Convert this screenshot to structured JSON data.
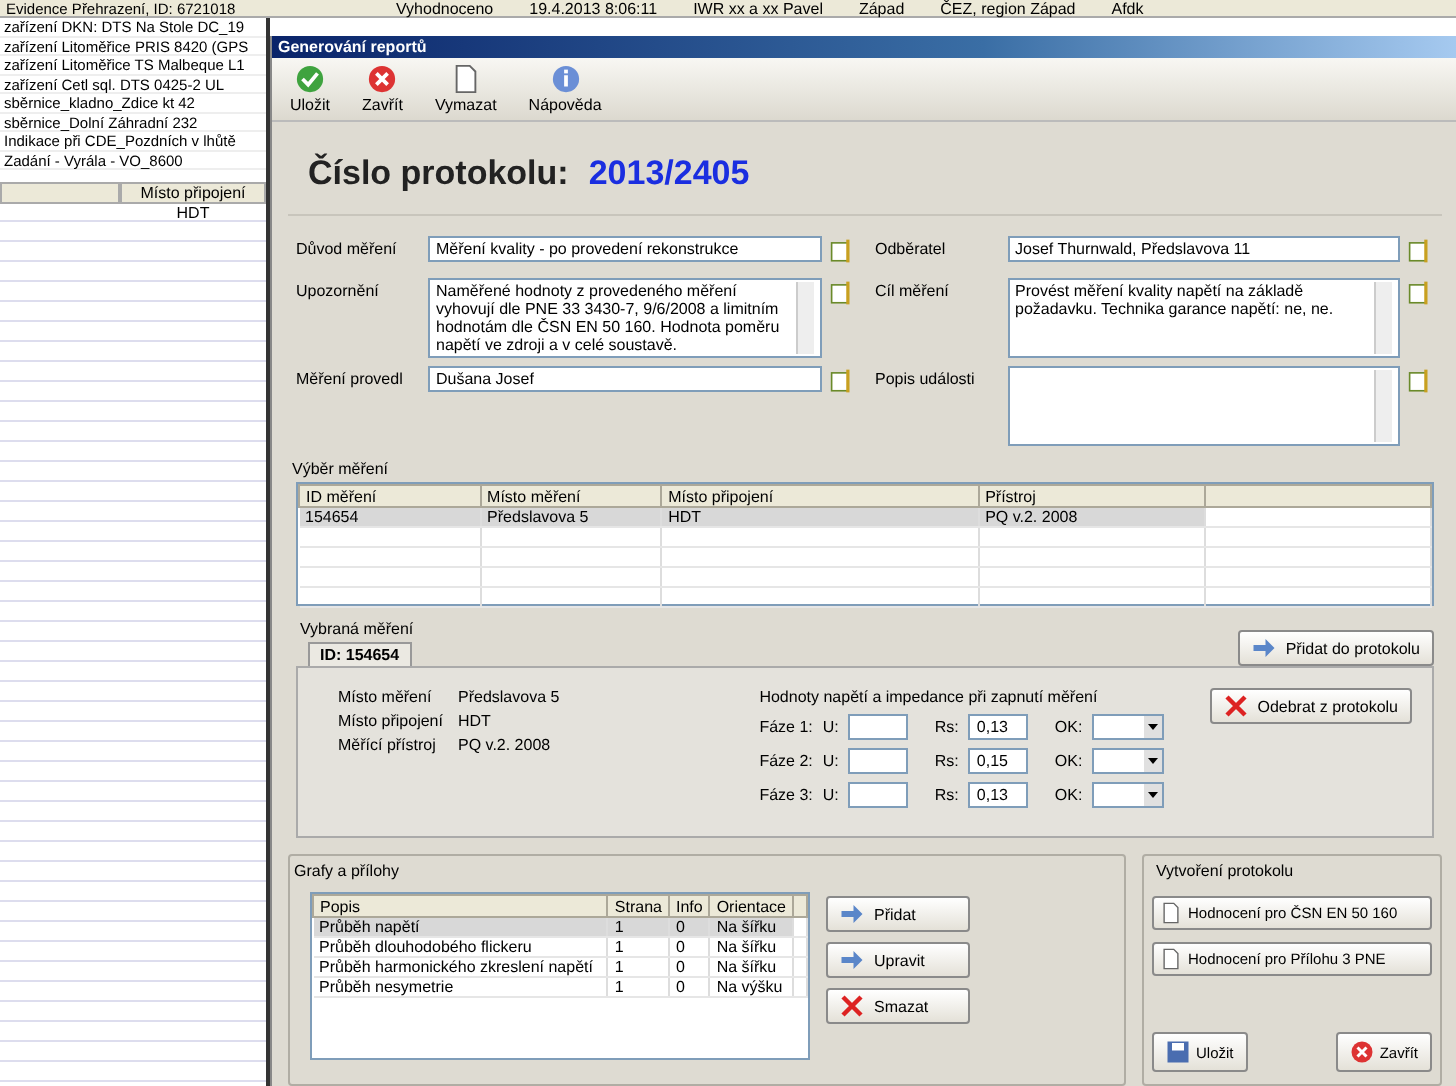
{
  "background_window": {
    "title": "Evidence Přehrazení, ID: 6721018",
    "status": [
      "Vyhodnoceno",
      "19.4.2013 8:06:11",
      "IWR xx a xx Pavel",
      "Západ",
      "ČEZ, region Západ",
      "Afdk"
    ],
    "list_items": [
      "zařízení DKN: DTS Na Stole DC_19",
      "zařízení Litoměřice PRIS 8420 (GPS",
      "zařízení Litoměřice TS Malbeque L1",
      "zařízení Cetl sql. DTS 0425-2 UL",
      "sběrnice_kladno_Zdice kt 42",
      "sběrnice_Dolní Záhradní 232",
      "Indikace při CDE_Pozdních v lhůtě",
      "Zadání - Vyrála - VO_8600"
    ],
    "table": {
      "column": "Místo připojení",
      "cell": "HDT"
    }
  },
  "dialog": {
    "title": "Generování reportů",
    "toolbar": [
      {
        "label": "Uložit"
      },
      {
        "label": "Zavřít"
      },
      {
        "label": "Vymazat"
      },
      {
        "label": "Nápověda"
      }
    ],
    "protocol_label": "Číslo protokolu:",
    "protocol_number": "2013/2405",
    "form_left": [
      {
        "label": "Důvod měření",
        "value": "Měření kvality - po provedení rekonstrukce",
        "kind": "text"
      },
      {
        "label": "Upozornění",
        "value": "Naměřené hodnoty z provedeného měření vyhovují dle PNE 33 3430-7, 9/6/2008 a limitním hodnotám dle ČSN EN 50 160. Hodnota poměru napětí ve zdroji a v celé soustavě.",
        "kind": "memo"
      },
      {
        "label": "Měření provedl",
        "value": "Dušana Josef",
        "kind": "text"
      }
    ],
    "form_right": [
      {
        "label": "Odběratel",
        "value": "Josef Thurnwald, Předslavova 11",
        "kind": "text"
      },
      {
        "label": "Cíl měření",
        "value": "Provést měření kvality napětí na základě požadavku. Technika garance napětí: ne, ne.",
        "kind": "memo"
      },
      {
        "label": "Popis události",
        "kind": "memo"
      }
    ],
    "selection": {
      "title": "Výběr měření",
      "columns": [
        "ID měření",
        "Místo měření",
        "Místo připojení",
        "Přístroj"
      ],
      "rows": [
        {
          "cells": [
            "154654",
            "Předslavova 5",
            "HDT",
            "PQ v.2. 2008"
          ],
          "selected": true
        }
      ],
      "add_button": "Přidat do protokolu"
    },
    "selected_measurements": {
      "title": "Vybraná měření",
      "tabs": [
        {
          "label": "ID: 154654",
          "selected": true
        }
      ],
      "details": [
        {
          "label": "Místo měření",
          "value": "Předslavova 5"
        },
        {
          "label": "Místo připojení",
          "value": "HDT"
        },
        {
          "label": "Měřící přístroj",
          "value": "PQ v.2. 2008"
        }
      ],
      "values_title": "Hodnoty napětí a impedance při zapnutí měření",
      "phases": [
        {
          "label": "Fáze 1:",
          "u_label": "U:",
          "rs_label": "Rs:",
          "rs": "0,13",
          "ok_label": "OK:"
        },
        {
          "label": "Fáze 2:",
          "u_label": "U:",
          "rs_label": "Rs:",
          "rs": "0,15",
          "ok_label": "OK:"
        },
        {
          "label": "Fáze 3:",
          "u_label": "U:",
          "rs_label": "Rs:",
          "rs": "0,13",
          "ok_label": "OK:"
        }
      ],
      "remove_button": "Odebrat z protokolu"
    },
    "attachments": {
      "title": "Grafy a přílohy",
      "columns": [
        "Popis",
        "Strana",
        "Info",
        "Orientace"
      ],
      "rows": [
        {
          "cells": [
            "Průběh napětí",
            "1",
            "0",
            "Na šířku"
          ],
          "selected": true
        },
        {
          "cells": [
            "Průběh dlouhodobého flickeru",
            "1",
            "0",
            "Na šířku"
          ],
          "selected": false
        },
        {
          "cells": [
            "Průběh harmonického zkreslení napětí",
            "1",
            "0",
            "Na šířku"
          ],
          "selected": false
        },
        {
          "cells": [
            "Průběh nesymetrie",
            "1",
            "0",
            "Na výšku"
          ],
          "selected": false
        }
      ],
      "buttons": [
        {
          "label": "Přidat"
        },
        {
          "label": "Upravit"
        },
        {
          "label": "Smazat"
        }
      ]
    },
    "create": {
      "title": "Vytvoření protokolu",
      "buttons": [
        "Hodnocení pro ČSN EN 50 160",
        "Hodnocení pro Přílohu 3 PNE"
      ]
    },
    "footer_buttons": [
      {
        "label": "Uložit"
      },
      {
        "label": "Zavřít"
      }
    ]
  }
}
